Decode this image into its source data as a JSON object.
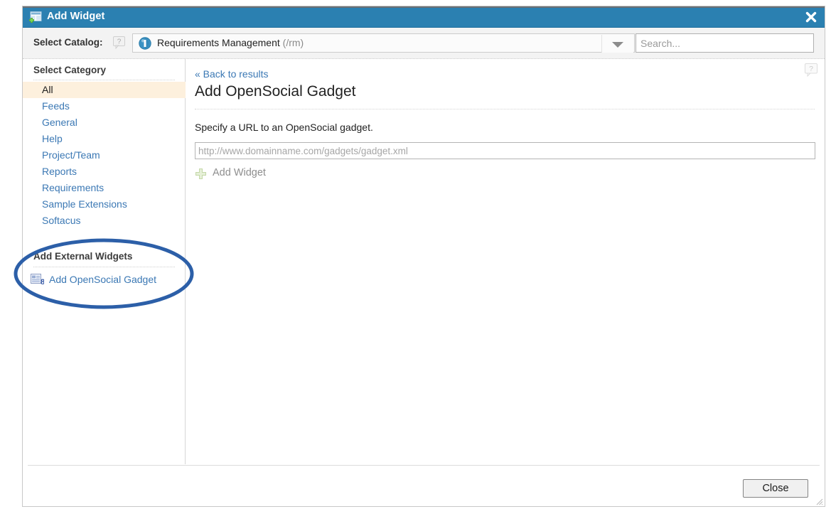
{
  "window": {
    "title": "Add Widget",
    "title_icon": "add-widget-icon",
    "close_icon": "close-icon"
  },
  "toolbar": {
    "catalog_label": "Select Catalog:",
    "catalog_help_icon": "help-question-icon",
    "catalog_selected_name": "Requirements Management",
    "catalog_selected_path": "(/rm)",
    "catalog_project_icon": "project-area-icon",
    "catalog_arrow_icon": "chevron-down-icon",
    "search_placeholder": "Search...",
    "search_value": ""
  },
  "sidebar": {
    "category_heading": "Select Category",
    "categories": [
      {
        "label": "All",
        "selected": true
      },
      {
        "label": "Feeds",
        "selected": false
      },
      {
        "label": "General",
        "selected": false
      },
      {
        "label": "Help",
        "selected": false
      },
      {
        "label": "Project/Team",
        "selected": false
      },
      {
        "label": "Reports",
        "selected": false
      },
      {
        "label": "Requirements",
        "selected": false
      },
      {
        "label": "Sample Extensions",
        "selected": false
      },
      {
        "label": "Softacus",
        "selected": false
      }
    ],
    "external_heading": "Add External Widgets",
    "external_link": "Add OpenSocial Gadget",
    "external_icon": "opensocial-gadget-icon"
  },
  "content": {
    "back_link": "« Back to results",
    "page_title": "Add OpenSocial Gadget",
    "instruction": "Specify a URL to an OpenSocial gadget.",
    "url_placeholder": "http://www.domainname.com/gadgets/gadget.xml",
    "url_value": "",
    "add_widget_label": "Add Widget",
    "add_widget_icon": "plus-icon",
    "help_icon": "help-question-icon"
  },
  "footer": {
    "close_label": "Close"
  },
  "annotation": {
    "shape": "ellipse-highlight",
    "color": "#2c5fa8"
  },
  "colors": {
    "titlebar": "#2b80b1",
    "link": "#3b78b4",
    "selected_row": "#fdf0dd",
    "annotation": "#2c5fa8"
  }
}
